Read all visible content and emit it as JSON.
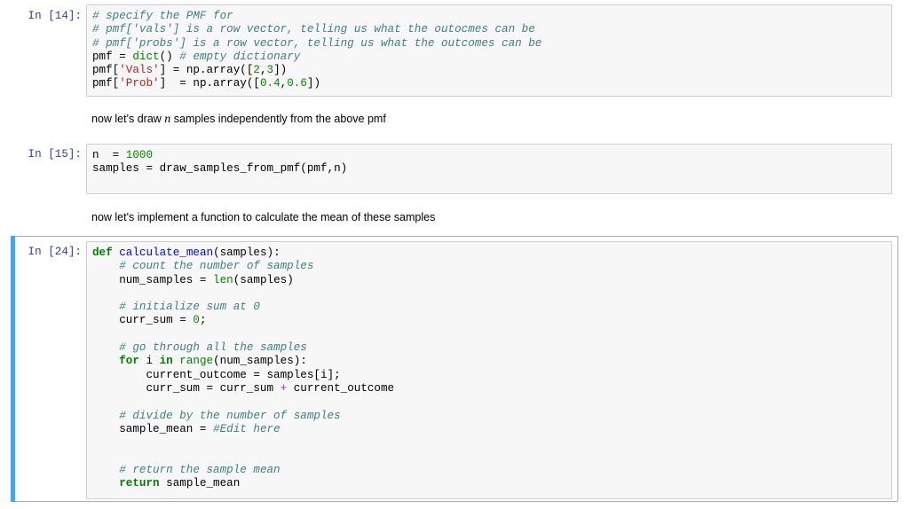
{
  "cells": [
    {
      "prompt": "In [14]:",
      "lines": [
        [
          [
            "c",
            "# specify the PMF for"
          ]
        ],
        [
          [
            "c",
            "# pmf['vals'] is a row vector, telling us what the outocmes can be"
          ]
        ],
        [
          [
            "c",
            "# pmf['probs'] is a row vector, telling us what the outcomes can be"
          ]
        ],
        [
          [
            "t",
            "pmf = "
          ],
          [
            "b",
            "dict"
          ],
          [
            "t",
            "() "
          ],
          [
            "c",
            "# empty dictionary"
          ]
        ],
        [
          [
            "t",
            "pmf["
          ],
          [
            "s",
            "'Vals'"
          ],
          [
            "t",
            "] = np.array(["
          ],
          [
            "n",
            "2"
          ],
          [
            "t",
            ","
          ],
          [
            "n",
            "3"
          ],
          [
            "t",
            "])"
          ]
        ],
        [
          [
            "t",
            "pmf["
          ],
          [
            "s",
            "'Prob'"
          ],
          [
            "t",
            "]  = np.array(["
          ],
          [
            "n",
            "0.4"
          ],
          [
            "t",
            ","
          ],
          [
            "n",
            "0.6"
          ],
          [
            "t",
            "])"
          ]
        ]
      ]
    },
    {
      "prompt": "In [15]:",
      "lines": [
        [
          [
            "t",
            "n  = "
          ],
          [
            "n",
            "1000"
          ]
        ],
        [
          [
            "t",
            "samples = draw_samples_from_pmf(pmf,n)"
          ]
        ],
        []
      ]
    },
    {
      "prompt": "In [24]:",
      "lines": [
        [
          [
            "k",
            "def"
          ],
          [
            "t",
            " "
          ],
          [
            "f",
            "calculate_mean"
          ],
          [
            "t",
            "(samples):"
          ]
        ],
        [
          [
            "t",
            "    "
          ],
          [
            "c",
            "# count the number of samples"
          ]
        ],
        [
          [
            "t",
            "    num_samples = "
          ],
          [
            "b",
            "len"
          ],
          [
            "t",
            "(samples)"
          ]
        ],
        [],
        [
          [
            "t",
            "    "
          ],
          [
            "c",
            "# initialize sum at 0"
          ]
        ],
        [
          [
            "t",
            "    curr_sum = "
          ],
          [
            "n",
            "0"
          ],
          [
            "t",
            ";"
          ]
        ],
        [],
        [
          [
            "t",
            "    "
          ],
          [
            "c",
            "# go through all the samples"
          ]
        ],
        [
          [
            "t",
            "    "
          ],
          [
            "k",
            "for"
          ],
          [
            "t",
            " i "
          ],
          [
            "k",
            "in"
          ],
          [
            "t",
            " "
          ],
          [
            "b",
            "range"
          ],
          [
            "t",
            "(num_samples):"
          ]
        ],
        [
          [
            "t",
            "        current_outcome = samples[i];"
          ]
        ],
        [
          [
            "t",
            "        curr_sum = curr_sum "
          ],
          [
            "o",
            "+"
          ],
          [
            "t",
            " current_outcome"
          ]
        ],
        [],
        [
          [
            "t",
            "    "
          ],
          [
            "c",
            "# divide by the number of samples"
          ]
        ],
        [
          [
            "t",
            "    sample_mean = "
          ],
          [
            "c",
            "#Edit here"
          ]
        ],
        [],
        [],
        [
          [
            "t",
            "    "
          ],
          [
            "c",
            "# return the sample mean"
          ]
        ],
        [
          [
            "t",
            "    "
          ],
          [
            "k",
            "return"
          ],
          [
            "t",
            " sample_mean"
          ]
        ]
      ]
    }
  ],
  "markdown": [
    {
      "before": "now let's draw ",
      "math": "n",
      "after": " samples independently from the above pmf"
    },
    {
      "before": "now let's implement a function to calculate the mean of these samples",
      "math": "",
      "after": ""
    }
  ],
  "colors": {
    "selected_bar": "#42A5F5",
    "prompt": "#303F9F"
  }
}
